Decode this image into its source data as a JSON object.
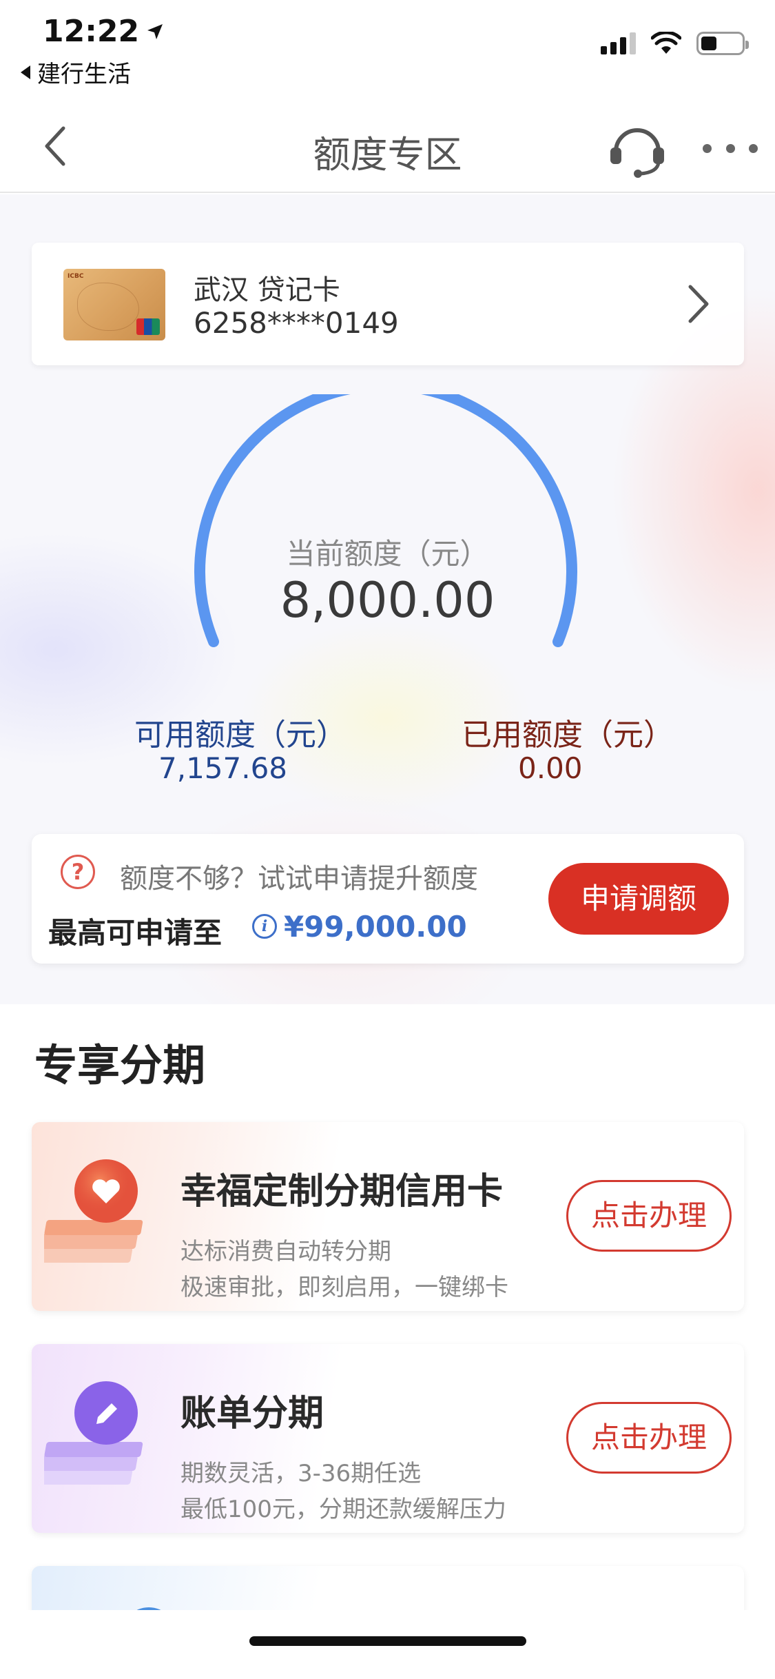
{
  "status_bar": {
    "time": "12:22",
    "back_app_label": "建行生活"
  },
  "nav": {
    "title": "额度专区"
  },
  "card": {
    "name": "武汉 贷记卡",
    "number": "6258****0149"
  },
  "limit": {
    "current_label": "当前额度（元）",
    "current_value": "8,000.00",
    "available_label": "可用额度（元）",
    "available_value": "7,157.68",
    "used_label": "已用额度（元）",
    "used_value": "0.00",
    "available_fraction": 0.895
  },
  "upgrade": {
    "hint": "额度不够？试试申请提升额度",
    "max_label": "最高可申请至",
    "max_amount": "¥99,000.00",
    "apply_button": "申请调额"
  },
  "installment": {
    "section_title": "专享分期",
    "items": [
      {
        "title": "幸福定制分期信用卡",
        "sub1": "达标消费自动转分期",
        "sub2": "极速审批，即刻启用，一键绑卡",
        "button": "点击办理",
        "icon": "heart-icon",
        "color": "#e4523c"
      },
      {
        "title": "账单分期",
        "sub1": "期数灵活，3-36期任选",
        "sub2": "最低100元，分期还款缓解压力",
        "button": "点击办理",
        "icon": "pencil-icon",
        "color": "#8a63e8"
      }
    ]
  },
  "colors": {
    "accent_red": "#d93024",
    "gauge_blue": "#5b96f0",
    "available_blue": "#22458e",
    "used_brown": "#7a2418"
  }
}
